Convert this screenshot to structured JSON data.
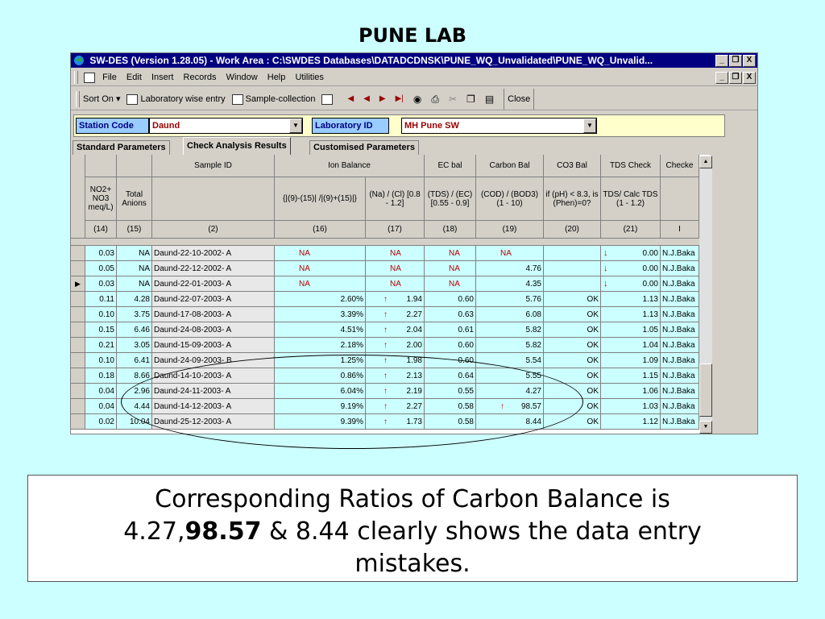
{
  "slide_title": "PUNE LAB",
  "window": {
    "title": "SW-DES (Version 1.28.05) - Work Area : C:\\SWDES Databases\\DATADCDNSK\\PUNE_WQ_Unvalidated\\PUNE_WQ_Unvalid...",
    "buttons": [
      "_",
      "❐",
      "X"
    ]
  },
  "menu": [
    "File",
    "Edit",
    "Insert",
    "Records",
    "Window",
    "Help",
    "Utilities"
  ],
  "toolbar": {
    "sort_on": "Sort On ▾",
    "lab_wise": "Laboratory wise entry",
    "sample_collection": "Sample-collection",
    "close": "Close"
  },
  "filter": {
    "station_label": "Station Code",
    "station_value": "Daund",
    "lab_label": "Laboratory ID",
    "lab_value": "MH Pune SW"
  },
  "tabs": [
    "Standard Parameters",
    "Check Analysis Results",
    "Customised Parameters"
  ],
  "columns": [
    {
      "h1": "",
      "h2": "NO2+ NO3 meq/L)",
      "num": "(14)"
    },
    {
      "h1": "",
      "h2": "Total Anions",
      "num": "(15)"
    },
    {
      "h1": "Sample ID",
      "h2": "",
      "num": "(2)"
    },
    {
      "h1": "Ion Balance",
      "h2": "{|(9)-(15)| /|(9)+(15)|}",
      "num": "(16)"
    },
    {
      "h1": "",
      "h2": "(Na) / (Cl)  [0.8 - 1.2]",
      "num": "(17)"
    },
    {
      "h1": "EC bal",
      "h2": "(TDS) / (EC) [0.55 - 0.9]",
      "num": "(18)"
    },
    {
      "h1": "Carbon Bal",
      "h2": "(COD) / (BOD3)  (1 - 10)",
      "num": "(19)"
    },
    {
      "h1": "CO3 Bal",
      "h2": "if (pH) < 8.3, is (Phen)=0?",
      "num": "(20)"
    },
    {
      "h1": "TDS Check",
      "h2": "TDS/ Calc TDS (1 - 1.2)",
      "num": "(21)"
    },
    {
      "h1": "Checke",
      "h2": "",
      "num": "I"
    }
  ],
  "rows": [
    {
      "c14": "0.03",
      "c15": "NA",
      "id": "Daund-22-10-2002- A",
      "ion": "NA",
      "na_cl": "NA",
      "na_up": false,
      "ec": "NA",
      "carbon": "NA",
      "c_up": false,
      "co3": "",
      "tds_dn": true,
      "tds": "0.00",
      "chk": "N.J.Baka"
    },
    {
      "c14": "0.05",
      "c15": "NA",
      "id": "Daund-22-12-2002- A",
      "ion": "NA",
      "na_cl": "NA",
      "na_up": false,
      "ec": "NA",
      "carbon": "4.76",
      "c_up": false,
      "co3": "",
      "tds_dn": true,
      "tds": "0.00",
      "chk": "N.J.Baka"
    },
    {
      "c14": "0.03",
      "c15": "NA",
      "id": "Daund-22-01-2003- A",
      "ion": "NA",
      "na_cl": "NA",
      "na_up": false,
      "ec": "NA",
      "carbon": "4.35",
      "c_up": false,
      "co3": "",
      "tds_dn": true,
      "tds": "0.00",
      "chk": "N.J.Baka",
      "current": true
    },
    {
      "c14": "0.11",
      "c15": "4.28",
      "id": "Daund-22-07-2003- A",
      "ion": "2.60%",
      "na_cl": "1.94",
      "na_up": true,
      "ec": "0.60",
      "carbon": "5.76",
      "c_up": false,
      "co3": "OK",
      "tds_dn": false,
      "tds": "1.13",
      "chk": "N.J.Baka"
    },
    {
      "c14": "0.10",
      "c15": "3.75",
      "id": "Daund-17-08-2003- A",
      "ion": "3.39%",
      "na_cl": "2.27",
      "na_up": true,
      "ec": "0.63",
      "carbon": "6.08",
      "c_up": false,
      "co3": "OK",
      "tds_dn": false,
      "tds": "1.13",
      "chk": "N.J.Baka"
    },
    {
      "c14": "0.15",
      "c15": "6.46",
      "id": "Daund-24-08-2003- A",
      "ion": "4.51%",
      "na_cl": "2.04",
      "na_up": true,
      "ec": "0.61",
      "carbon": "5.82",
      "c_up": false,
      "co3": "OK",
      "tds_dn": false,
      "tds": "1.05",
      "chk": "N.J.Baka"
    },
    {
      "c14": "0.21",
      "c15": "3.05",
      "id": "Daund-15-09-2003- A",
      "ion": "2.18%",
      "na_cl": "2.00",
      "na_up": true,
      "ec": "0.60",
      "carbon": "5.82",
      "c_up": false,
      "co3": "OK",
      "tds_dn": false,
      "tds": "1.04",
      "chk": "N.J.Baka"
    },
    {
      "c14": "0.10",
      "c15": "6.41",
      "id": "Daund-24-09-2003- B",
      "ion": "1.25%",
      "na_cl": "1.98",
      "na_up": true,
      "ec": "0.60",
      "carbon": "5.54",
      "c_up": false,
      "co3": "OK",
      "tds_dn": false,
      "tds": "1.09",
      "chk": "N.J.Baka"
    },
    {
      "c14": "0.18",
      "c15": "8.66",
      "id": "Daund-14-10-2003- A",
      "ion": "0.86%",
      "na_cl": "2.13",
      "na_up": true,
      "ec": "0.64",
      "carbon": "5.55",
      "c_up": false,
      "co3": "OK",
      "tds_dn": false,
      "tds": "1.15",
      "chk": "N.J.Baka"
    },
    {
      "c14": "0.04",
      "c15": "2.96",
      "id": "Daund-24-11-2003- A",
      "ion": "6.04%",
      "na_cl": "2.19",
      "na_up": true,
      "ec": "0.55",
      "carbon": "4.27",
      "c_up": false,
      "co3": "OK",
      "tds_dn": false,
      "tds": "1.06",
      "chk": "N.J.Baka"
    },
    {
      "c14": "0.04",
      "c15": "4.44",
      "id": "Daund-14-12-2003- A",
      "ion": "9.19%",
      "na_cl": "2.27",
      "na_up": true,
      "ec": "0.58",
      "carbon": "98.57",
      "c_up": true,
      "co3": "OK",
      "tds_dn": false,
      "tds": "1.03",
      "chk": "N.J.Baka"
    },
    {
      "c14": "0.02",
      "c15": "10.04",
      "id": "Daund-25-12-2003- A",
      "ion": "9.39%",
      "na_cl": "1.73",
      "na_up": true,
      "ec": "0.58",
      "carbon": "8.44",
      "c_up": false,
      "co3": "OK",
      "tds_dn": false,
      "tds": "1.12",
      "chk": "N.J.Baka"
    }
  ],
  "caption": {
    "line1": "Corresponding Ratios of Carbon Balance is",
    "pre": "4.27,",
    "bold": "98.57",
    "post": " & 8.44 clearly shows the data entry",
    "line3": "mistakes."
  }
}
